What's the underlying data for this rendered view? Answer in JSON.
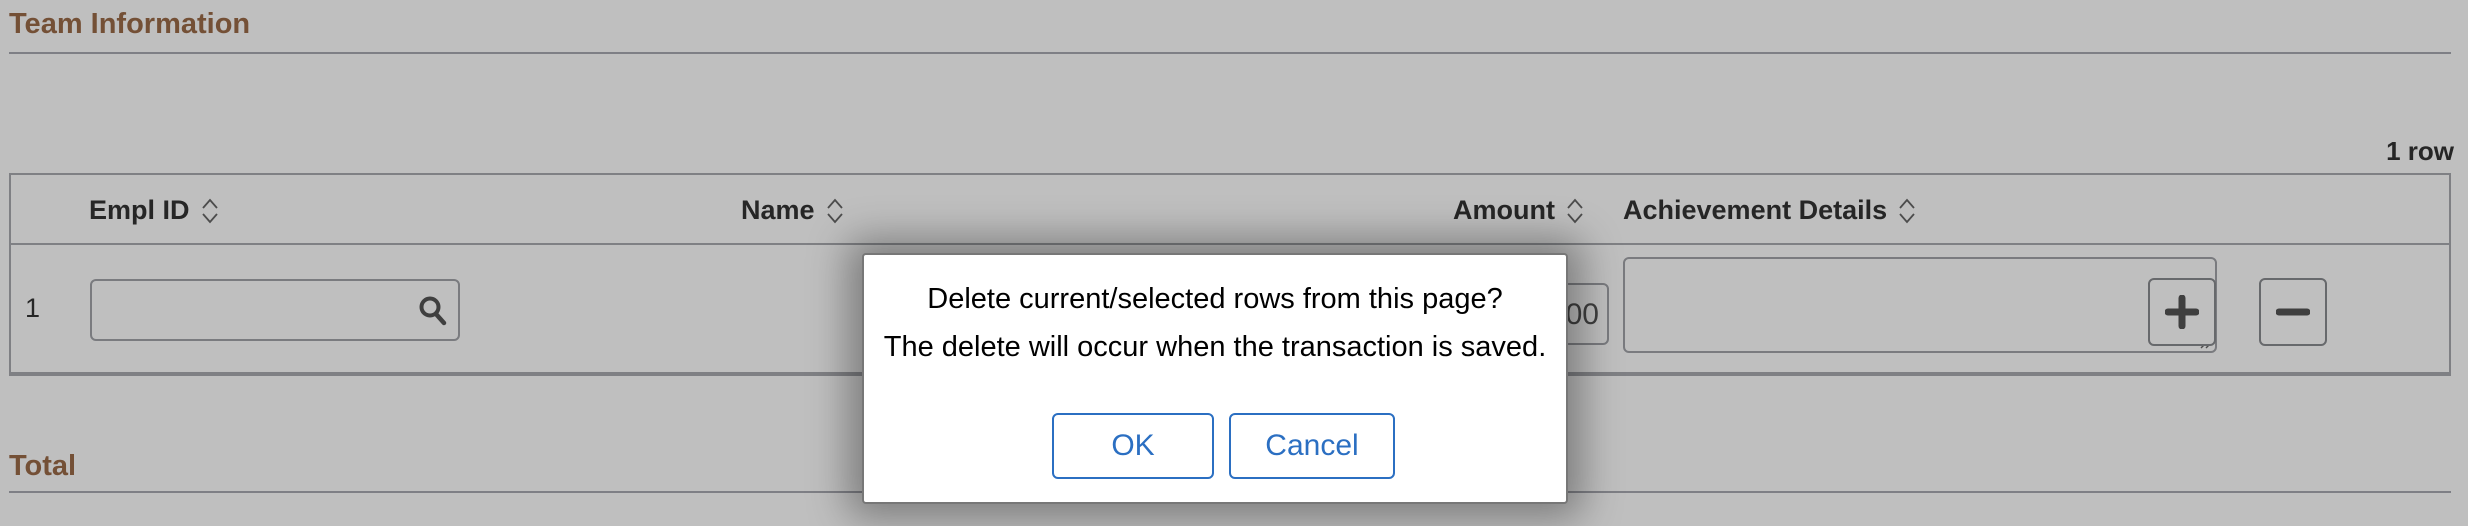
{
  "sections": {
    "team_information": "Team Information",
    "total": "Total"
  },
  "grid": {
    "row_count": "1 row",
    "columns": [
      {
        "label": "Empl ID",
        "sortable": true
      },
      {
        "label": "Name",
        "sortable": true
      },
      {
        "label": "Amount",
        "sortable": true
      },
      {
        "label": "Achievement Details",
        "sortable": true
      }
    ],
    "rows": [
      {
        "row_number": "1",
        "empl_id": "",
        "name": "",
        "amount_visible": "00",
        "achievement_details": ""
      }
    ],
    "icons": {
      "lookup": "search-icon",
      "add_row": "plus-icon",
      "delete_row": "minus-icon",
      "sort": "sort-icon"
    }
  },
  "dialog": {
    "message_line1": "Delete current/selected rows from this page?",
    "message_line2": "The delete will occur when the transaction is saved.",
    "ok_label": "OK",
    "cancel_label": "Cancel"
  },
  "colors": {
    "section_title": "#9b6b49",
    "dialog_button": "#2b6fc2",
    "overlay": "rgba(0,0,0,0.25)"
  }
}
